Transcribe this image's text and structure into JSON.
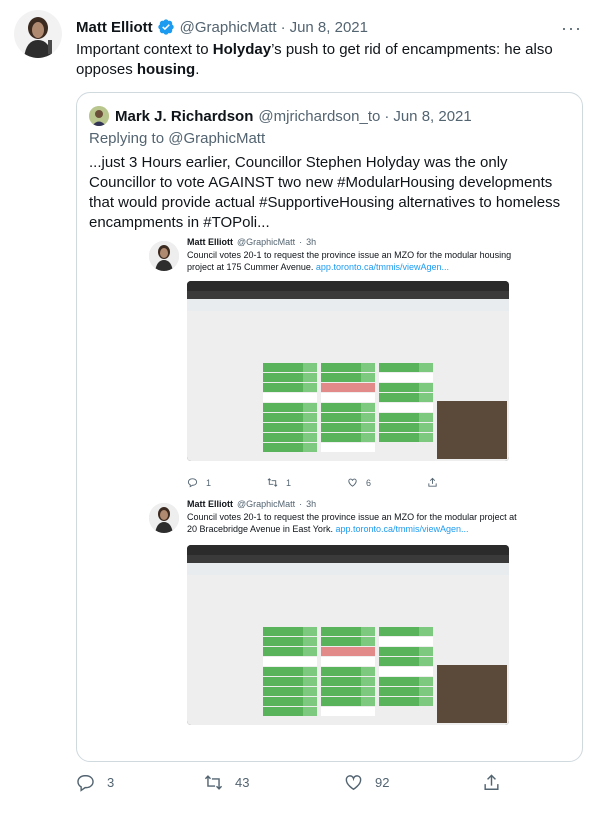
{
  "tweet": {
    "author_name": "Matt Elliott",
    "handle": "@GraphicMatt",
    "date": "Jun 8, 2021",
    "more_label": "···",
    "text_parts": [
      "Important context to ",
      "Holyday",
      "’s push to get rid of encampments: he also opposes ",
      "housing",
      "."
    ],
    "actions": {
      "replies": "3",
      "retweets": "43",
      "likes": "92"
    }
  },
  "quoted": {
    "author_name": "Mark J. Richardson",
    "handle": "@mjrichardson_to",
    "date": "Jun 8, 2021",
    "replying_prefix": "Replying to ",
    "replying_to": "@GraphicMatt",
    "text": "...just 3 Hours earlier, Councillor Stephen Holyday was the only Councillor to vote AGAINST two new #ModularHousing developments that would provide actual #SupportiveHousing alternatives to homeless encampments in #TOPoli...",
    "embedded": [
      {
        "author_name": "Matt Elliott",
        "handle": "@GraphicMatt",
        "time": "3h",
        "text": "Council votes 20-1 to request the province issue an MZO for the modular housing project at 175 Cummer Avenue.",
        "link": "app.toronto.ca/tmmis/viewAgen...",
        "actions": {
          "replies": "1",
          "retweets": "1",
          "likes": "6"
        }
      },
      {
        "author_name": "Matt Elliott",
        "handle": "@GraphicMatt",
        "time": "3h",
        "text": "Council votes 20-1 to request the province issue an MZO for the modular project at 20 Bracebridge Avenue in East York.",
        "link": "app.toronto.ca/tmmis/viewAgen...",
        "actions": {
          "replies": "",
          "retweets": "",
          "likes": ""
        }
      }
    ]
  },
  "colors": {
    "accent": "#1d9bf0",
    "muted": "#536471",
    "border": "#cfd9de"
  },
  "icons": [
    "verified-badge-icon",
    "more-icon",
    "reply-icon",
    "retweet-icon",
    "like-icon",
    "share-icon"
  ]
}
